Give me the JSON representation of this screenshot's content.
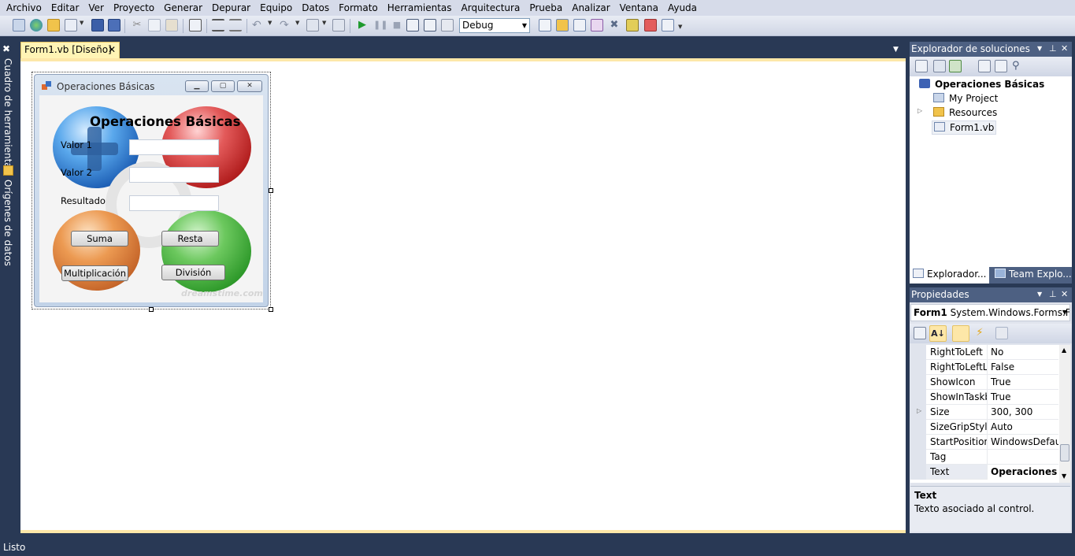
{
  "menu": [
    "Archivo",
    "Editar",
    "Ver",
    "Proyecto",
    "Generar",
    "Depurar",
    "Equipo",
    "Datos",
    "Formato",
    "Herramientas",
    "Arquitectura",
    "Prueba",
    "Analizar",
    "Ventana",
    "Ayuda"
  ],
  "toolbar": {
    "config_value": "Debug"
  },
  "left_strip": {
    "toolbox": "Cuadro de herramientas",
    "datasources": "Orígenes de datos"
  },
  "doc_tab": {
    "label": "Form1.vb [Diseño]",
    "close": "✕"
  },
  "form": {
    "title": "Operaciones Básicas",
    "heading": "Operaciones Básicas",
    "label_valor1": "Valor 1",
    "label_valor2": "Valor 2",
    "label_resultado": "Resultado",
    "btn_suma": "Suma",
    "btn_resta": "Resta",
    "btn_multiplicacion": "Multiplicación",
    "btn_division": "División",
    "watermark": "dreamstime.com"
  },
  "solution_explorer": {
    "title": "Explorador de soluciones",
    "root": "Operaciones Básicas",
    "items": [
      "My Project",
      "Resources",
      "Form1.vb"
    ],
    "tab1": "Explorador...",
    "tab2": "Team Explo..."
  },
  "properties": {
    "title": "Propiedades",
    "object_name": "Form1",
    "object_type": "System.Windows.Forms.Fo",
    "rows": [
      {
        "name": "RightToLeft",
        "value": "No"
      },
      {
        "name": "RightToLeftLa",
        "value": "False"
      },
      {
        "name": "ShowIcon",
        "value": "True"
      },
      {
        "name": "ShowInTaskb",
        "value": "True"
      },
      {
        "name": "Size",
        "value": "300, 300"
      },
      {
        "name": "SizeGripStyle",
        "value": "Auto"
      },
      {
        "name": "StartPosition",
        "value": "WindowsDefault"
      },
      {
        "name": "Tag",
        "value": ""
      },
      {
        "name": "Text",
        "value": "Operaciones Bá"
      }
    ],
    "desc_title": "Text",
    "desc_text": "Texto asociado al control."
  },
  "status": "Listo",
  "colors": {
    "chrome": "#293955",
    "menubar": "#d6dbe9",
    "panel_title": "#4d6082",
    "tab_active": "#fff4b5"
  }
}
